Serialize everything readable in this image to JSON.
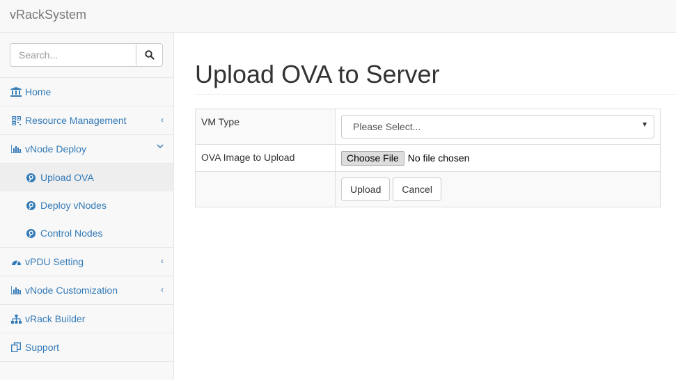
{
  "app": {
    "brand": "vRackSystem"
  },
  "sidebar": {
    "search_placeholder": "Search...",
    "items": [
      {
        "label": "Home",
        "icon": "bank-icon"
      },
      {
        "label": "Resource Management",
        "icon": "qrcode-icon",
        "arrow": "‹"
      },
      {
        "label": "vNode Deploy",
        "icon": "bar-chart-icon",
        "arrow": "⌄"
      },
      {
        "label": "vPDU Setting",
        "icon": "dashboard-icon",
        "arrow": "‹"
      },
      {
        "label": "vNode Customization",
        "icon": "bar-chart-icon",
        "arrow": "‹"
      },
      {
        "label": "vRack Builder",
        "icon": "sitemap-icon"
      },
      {
        "label": "Support",
        "icon": "copy-icon"
      }
    ],
    "subitems": [
      {
        "label": "Upload OVA",
        "icon": "pinterest-icon",
        "active": true
      },
      {
        "label": "Deploy vNodes",
        "icon": "pinterest-icon"
      },
      {
        "label": "Control Nodes",
        "icon": "pinterest-icon"
      }
    ]
  },
  "main": {
    "title": "Upload OVA to Server",
    "form": {
      "vm_type_label": "VM Type",
      "vm_type_value": "Please Select...",
      "ova_label": "OVA Image to Upload",
      "choose_file_label": "Choose File",
      "no_file_text": "No file chosen",
      "upload_label": "Upload",
      "cancel_label": "Cancel"
    }
  },
  "colors": {
    "link": "#337ab7",
    "navbar_bg": "#f8f8f8",
    "border": "#e7e7e7"
  }
}
